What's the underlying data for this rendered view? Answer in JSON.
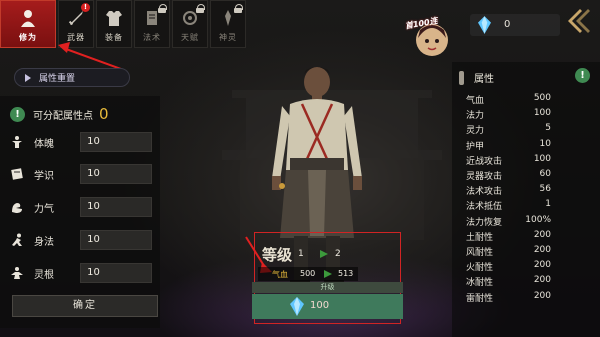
{
  "tabs": [
    {
      "label": "修为",
      "icon": "cultivator-icon",
      "active": true
    },
    {
      "label": "武器",
      "icon": "weapon-icon",
      "badge": "!"
    },
    {
      "label": "装备",
      "icon": "armor-icon"
    },
    {
      "label": "法术",
      "icon": "spell-icon",
      "locked": true
    },
    {
      "label": "天赋",
      "icon": "talent-icon",
      "locked": true
    },
    {
      "label": "神灵",
      "icon": "deity-icon",
      "locked": true
    }
  ],
  "left_panel": {
    "reset_label": "属性重置",
    "points_label": "可分配属性点",
    "points_value": "0",
    "stats": [
      {
        "name": "体魄",
        "value": "10",
        "icon": "body-icon"
      },
      {
        "name": "学识",
        "value": "10",
        "icon": "book-icon"
      },
      {
        "name": "力气",
        "value": "10",
        "icon": "strength-icon"
      },
      {
        "name": "身法",
        "value": "10",
        "icon": "agility-icon"
      },
      {
        "name": "灵根",
        "value": "10",
        "icon": "spirit-root-icon"
      }
    ],
    "confirm_label": "确定"
  },
  "level_up": {
    "title": "等级",
    "current_level": "1",
    "next_level": "2",
    "stat_name": "气血",
    "stat_current": "500",
    "stat_next": "513",
    "upgrade_label": "升级",
    "cost": "100"
  },
  "top_right": {
    "promo_text": "首100连",
    "currency_value": "0"
  },
  "attributes": {
    "title": "属性",
    "rows": [
      {
        "name": "气血",
        "value": "500"
      },
      {
        "name": "法力",
        "value": "100"
      },
      {
        "name": "灵力",
        "value": "5"
      },
      {
        "name": "护甲",
        "value": "10"
      },
      {
        "name": "近战攻击",
        "value": "100"
      },
      {
        "name": "灵器攻击",
        "value": "60"
      },
      {
        "name": "法术攻击",
        "value": "56"
      },
      {
        "name": "法术抵伍",
        "value": "1"
      },
      {
        "name": "法力恢复",
        "value": "100%"
      },
      {
        "name": "土耐性",
        "value": "200"
      },
      {
        "name": "风耐性",
        "value": "200"
      },
      {
        "name": "火耐性",
        "value": "200"
      },
      {
        "name": "冰耐性",
        "value": "200"
      },
      {
        "name": "雷耐性",
        "value": "200"
      }
    ]
  },
  "colors": {
    "active_tab": "#a51c1c",
    "annotation": "#e02020",
    "upgrade_button": "#3f7a5c",
    "highlight_gold": "#e6b93a",
    "notice_green": "#3f8a52"
  }
}
